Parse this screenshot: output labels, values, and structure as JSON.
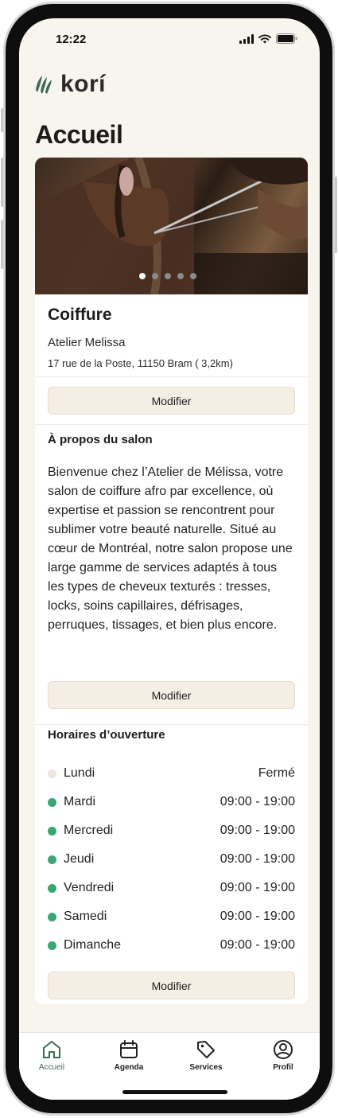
{
  "status_bar": {
    "time": "12:22"
  },
  "brand": {
    "name": "korí",
    "color": "#3f6b52"
  },
  "page": {
    "title": "Accueil"
  },
  "carousel": {
    "slides": 5,
    "active": 1
  },
  "service": {
    "title": "Coiffure",
    "salon_name": "Atelier Melissa",
    "address": "17 rue de la Poste, 11150 Bram ( 3,2km)",
    "edit_label": "Modifier"
  },
  "about": {
    "title": "À propos du salon",
    "text": "Bienvenue chez l’Atelier de Mélissa, votre salon de coiffure afro par excellence, où expertise et passion se rencontrent pour sublimer votre beauté naturelle. Situé au cœur de Montréal, notre salon propose une large gamme de services adaptés à tous les types de cheveux texturés : tresses, locks, soins capillaires, défrisages, perruques, tissages, et bien plus encore.",
    "edit_label": "Modifier"
  },
  "hours": {
    "title": "Horaires d’ouverture",
    "open_color": "#3aa772",
    "closed_color": "#ebe5dd",
    "days": [
      {
        "day": "Lundi",
        "time": "Fermé",
        "open": false
      },
      {
        "day": "Mardi",
        "time": "09:00 - 19:00",
        "open": true
      },
      {
        "day": "Mercredi",
        "time": "09:00 - 19:00",
        "open": true
      },
      {
        "day": "Jeudi",
        "time": "09:00 - 19:00",
        "open": true
      },
      {
        "day": "Vendredi",
        "time": "09:00 - 19:00",
        "open": true
      },
      {
        "day": "Samedi",
        "time": "09:00 - 19:00",
        "open": true
      },
      {
        "day": "Dimanche",
        "time": "09:00 - 19:00",
        "open": true
      }
    ],
    "edit_label": "Modifier"
  },
  "tabbar": {
    "items": [
      {
        "label": "Accueil",
        "icon": "home-icon",
        "active": true
      },
      {
        "label": "Agenda",
        "icon": "calendar-icon",
        "active": false
      },
      {
        "label": "Services",
        "icon": "tag-icon",
        "active": false
      },
      {
        "label": "Profil",
        "icon": "user-icon",
        "active": false
      }
    ]
  }
}
